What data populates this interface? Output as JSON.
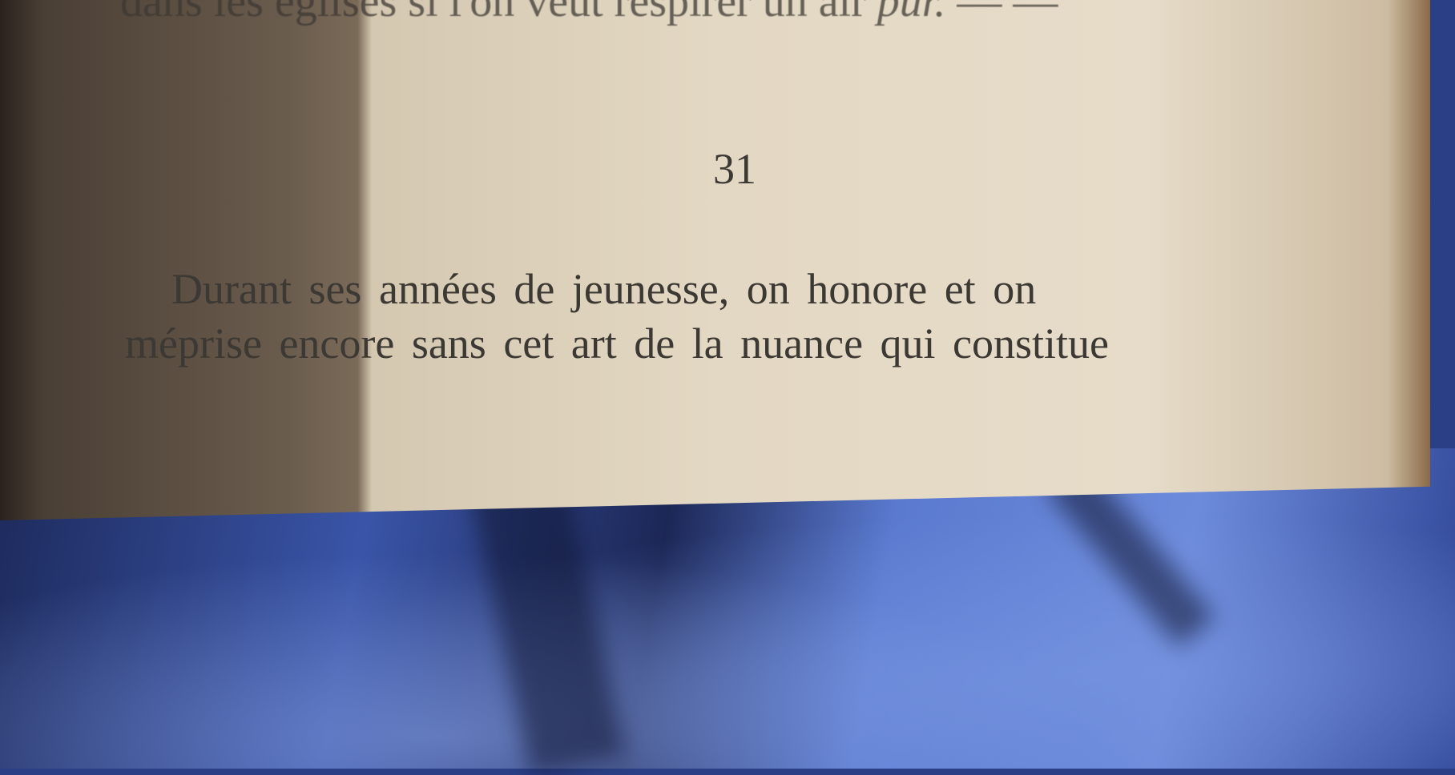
{
  "page": {
    "top_line": "dans les églises si l'on veut respirer un air",
    "top_line_italic": "pur.",
    "top_line_dashes": "— —",
    "section_number": "31",
    "paragraph_lines": [
      "Durant ses années de jeunesse, on honore et on",
      "méprise encore sans cet art de la nuance qui constitue"
    ]
  },
  "colors": {
    "paper": "#e3d8c3",
    "ink": "#3c3833",
    "cloth": "#4a66c0"
  }
}
